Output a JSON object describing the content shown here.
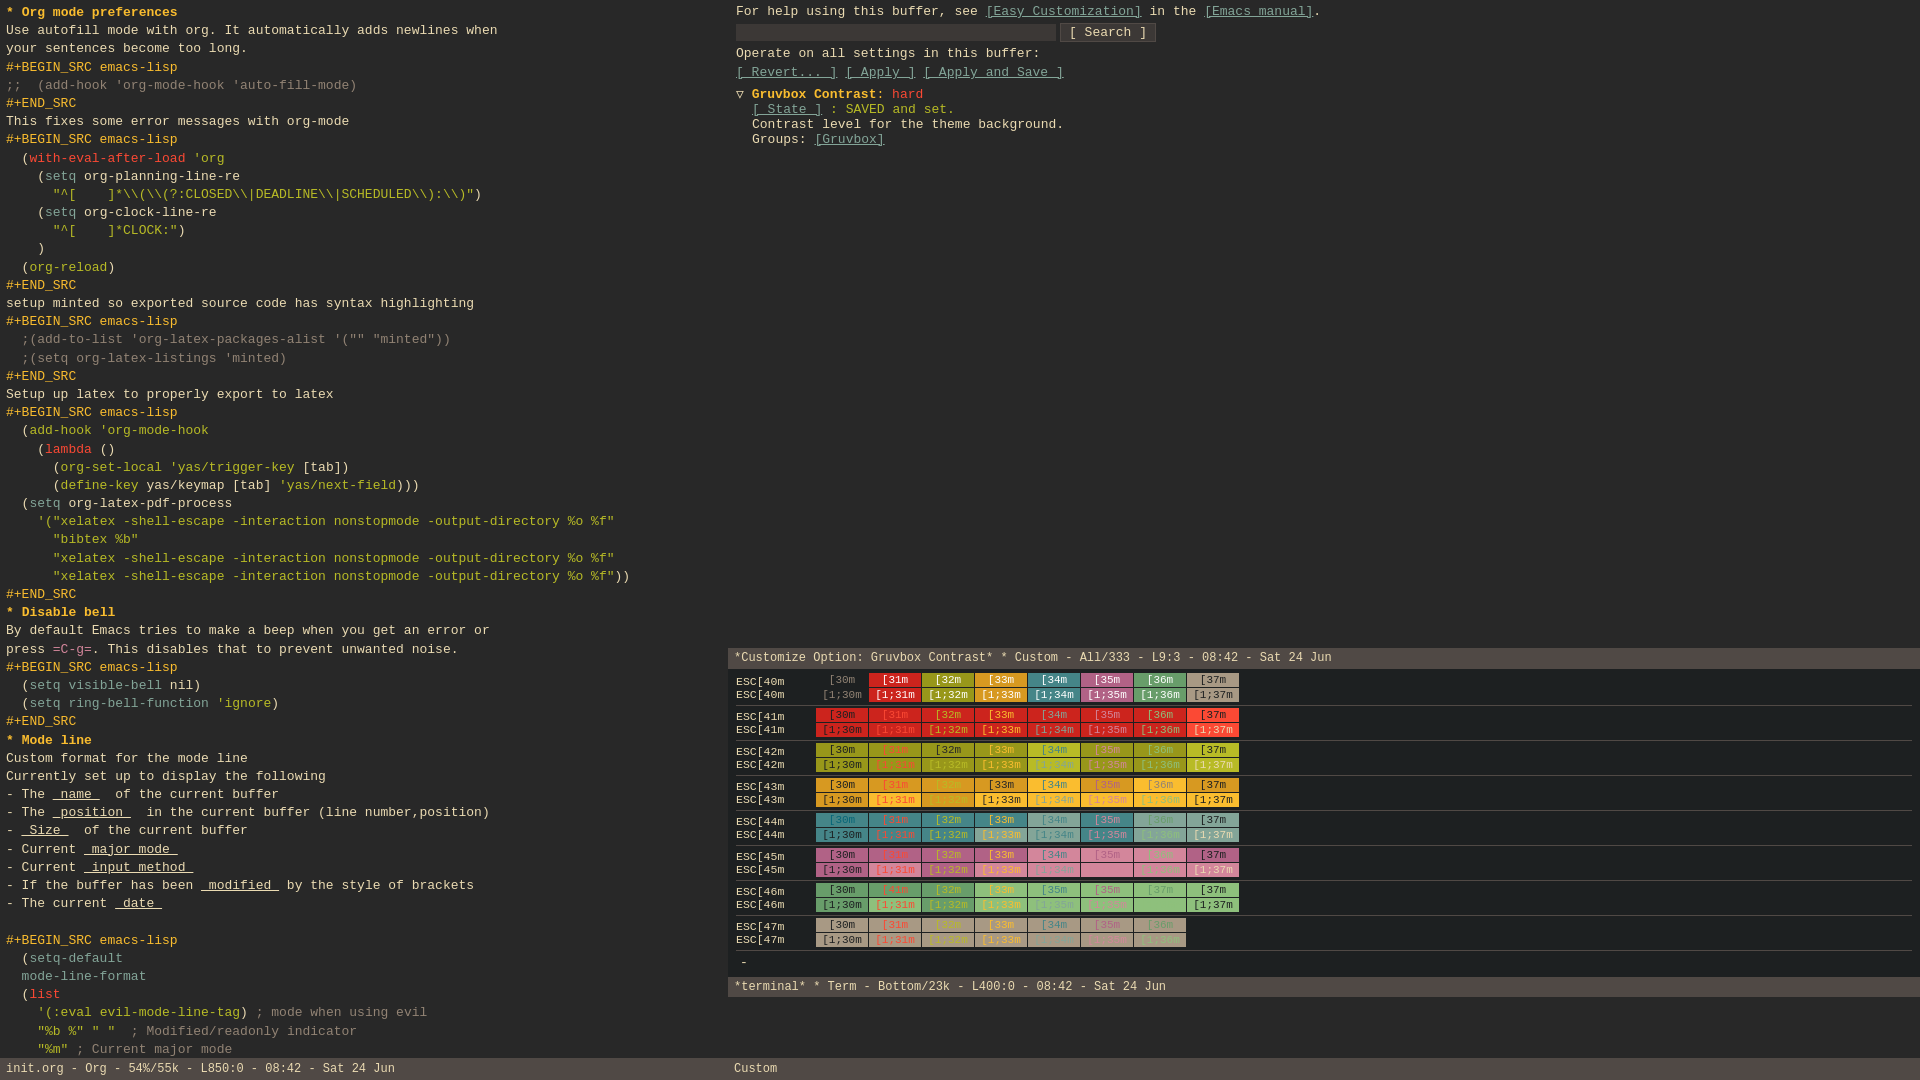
{
  "left": {
    "status": "init.org - Org - 54%/55k - L850:0 - 08:42 - Sat 24 Jun"
  },
  "right": {
    "customize_status": "*Customize Option: Gruvbox Contrast* * Custom - All/333 - L9:3 - 08:42 - Sat 24 Jun",
    "terminal_status": "*terminal* * Term - Bottom/23k - L400:0 - 08:42 - Sat 24 Jun",
    "help_text": "For help using this buffer, see",
    "easy_customization": "[Easy Customization]",
    "in_the": "in the",
    "emacs_manual": "[Emacs manual]",
    "operate_text": "Operate on all settings in this buffer:",
    "revert_btn": "[ Revert... ]",
    "apply_btn": "[ Apply ]",
    "apply_save_btn": "[ Apply and Save ]",
    "search_btn": "[ Search ]",
    "search_placeholder": "",
    "option_triangle": "▽",
    "option_name": "Gruvbox Contrast",
    "option_colon": ":",
    "option_value": "hard",
    "state_label": "[ State ]",
    "state_text": ": SAVED and set.",
    "contrast_desc": "Contrast level for the theme background.",
    "groups_label": "Groups:",
    "groups_link": "[Gruvbox]"
  },
  "term_rows": [
    {
      "labels": [
        "ESC[40m",
        "ESC[40m"
      ],
      "row1": [
        {
          "text": "[30m",
          "bg": "#1d2021",
          "fg": "#928374"
        },
        {
          "text": "[31m",
          "bg": "#cc241d",
          "fg": "#fff"
        },
        {
          "text": "[32m",
          "bg": "#98971a",
          "fg": "#fff"
        },
        {
          "text": "[33m",
          "bg": "#d79921",
          "fg": "#fff"
        },
        {
          "text": "[34m",
          "bg": "#458588",
          "fg": "#fff"
        },
        {
          "text": "[35m",
          "bg": "#b16286",
          "fg": "#fff"
        },
        {
          "text": "[36m",
          "bg": "#689d6a",
          "fg": "#fff"
        },
        {
          "text": "[37m",
          "bg": "#a89984",
          "fg": "#1d2021"
        }
      ],
      "row2": [
        {
          "text": "[1;30m",
          "bg": "#1d2021",
          "fg": "#928374"
        },
        {
          "text": "[1;31m",
          "bg": "#cc241d",
          "fg": "#fff"
        },
        {
          "text": "[1;32m",
          "bg": "#98971a",
          "fg": "#fff"
        },
        {
          "text": "[1;33m",
          "bg": "#d79921",
          "fg": "#fff"
        },
        {
          "text": "[1;34m",
          "bg": "#458588",
          "fg": "#fff"
        },
        {
          "text": "[1;35m",
          "bg": "#b16286",
          "fg": "#fff"
        },
        {
          "text": "[1;36m",
          "bg": "#689d6a",
          "fg": "#fff"
        },
        {
          "text": "[1;37m",
          "bg": "#a89984",
          "fg": "#1d2021"
        }
      ]
    }
  ]
}
